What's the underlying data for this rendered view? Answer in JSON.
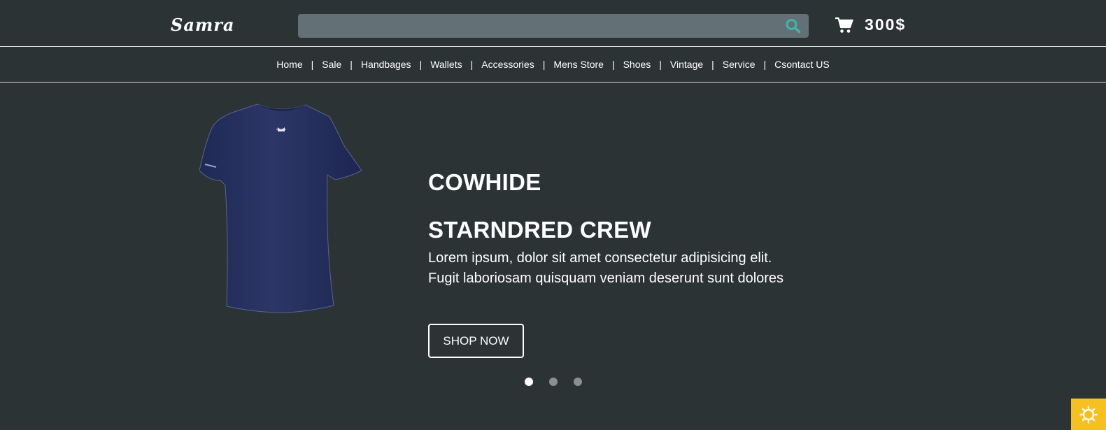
{
  "header": {
    "logo": "Samra",
    "search": {
      "placeholder": "",
      "value": "",
      "icon": "search-icon"
    },
    "cart": {
      "icon": "cart-icon",
      "total": "300$"
    }
  },
  "nav": {
    "items": [
      "Home",
      "Sale",
      "Handbages",
      "Wallets",
      "Accessories",
      "Mens Store",
      "Shoes",
      "Vintage",
      "Service",
      "Csontact US"
    ],
    "separator": "|"
  },
  "hero": {
    "image": "navy-tshirt-image",
    "title_line1": "COWHIDE",
    "title_line2": "STARNDRED CREW",
    "description": "Lorem ipsum, dolor sit amet consectetur adipisicing elit. Fugit laboriosam quisquam veniam deserunt sunt dolores",
    "button_label": "SHOP NOW"
  },
  "carousel": {
    "slide_count": 3,
    "active_index": 0
  },
  "theme_toggle": {
    "icon": "sun-icon"
  },
  "colors": {
    "background": "#2c3335",
    "search_bg": "#637176",
    "search_icon": "#3fb6a8",
    "tshirt": "#25305f",
    "toggle_bg": "#f7c021",
    "dot_inactive": "#8a9092",
    "dot_active": "#ffffff"
  }
}
